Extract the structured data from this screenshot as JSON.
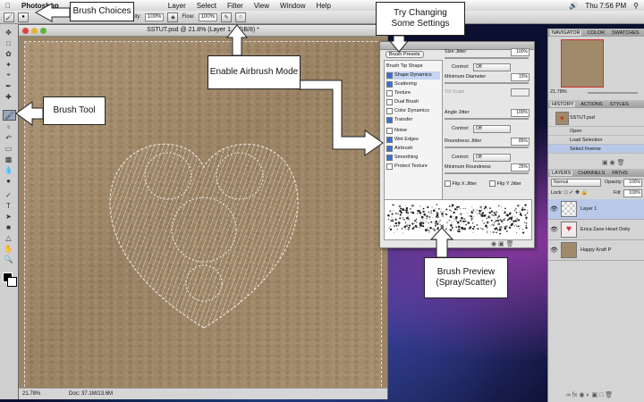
{
  "menubar": {
    "app_name": "Photoshop",
    "items": [
      "Layer",
      "Select",
      "Filter",
      "View",
      "Window",
      "Help"
    ],
    "clock": "Thu 7:56 PM"
  },
  "options_bar": {
    "opacity_label": "Opacity:",
    "opacity_value": "100%",
    "flow_label": "Flow:",
    "flow_value": "100%"
  },
  "document": {
    "title": "SSTUT.psd @ 21.8% (Layer 1, RGB/8) *",
    "zoom": "21.78%",
    "doc_size": "Doc: 37.1M/13.6M"
  },
  "brush_panel": {
    "presets_button": "Brush Presets",
    "options": [
      {
        "label": "Brush Tip Shape",
        "checked": false,
        "selected": false
      },
      {
        "label": "Shape Dynamics",
        "checked": true,
        "selected": true
      },
      {
        "label": "Scattering",
        "checked": true,
        "selected": false
      },
      {
        "label": "Texture",
        "checked": false,
        "selected": false
      },
      {
        "label": "Dual Brush",
        "checked": false,
        "selected": false
      },
      {
        "label": "Color Dynamics",
        "checked": false,
        "selected": false
      },
      {
        "label": "Transfer",
        "checked": true,
        "selected": false
      },
      {
        "label": "Noise",
        "checked": false,
        "selected": false
      },
      {
        "label": "Wet Edges",
        "checked": true,
        "selected": false
      },
      {
        "label": "Airbrush",
        "checked": true,
        "selected": false
      },
      {
        "label": "Smoothing",
        "checked": true,
        "selected": false
      },
      {
        "label": "Protect Texture",
        "checked": false,
        "selected": false
      }
    ],
    "size_jitter_label": "Size Jitter",
    "size_jitter_value": "100%",
    "control_label": "Control:",
    "control_value": "Off",
    "min_diameter_label": "Minimum Diameter",
    "min_diameter_value": "15%",
    "tilt_scale_label": "Tilt Scale",
    "angle_jitter_label": "Angle Jitter",
    "angle_jitter_value": "100%",
    "roundness_jitter_label": "Roundness Jitter",
    "roundness_jitter_value": "85%",
    "min_roundness_label": "Minimum Roundness",
    "min_roundness_value": "25%",
    "flip_x_label": "Flip X Jitter",
    "flip_y_label": "Flip Y Jitter"
  },
  "right_panels": {
    "nav_tabs": [
      "NAVIGATOR",
      "COLOR",
      "SWATCHES"
    ],
    "nav_zoom": "21.78%",
    "history_tabs": [
      "HISTORY",
      "ACTIONS",
      "STYLES"
    ],
    "history_items": [
      "SSTUT.psd",
      "Open",
      "Load Selection",
      "Select Inverse"
    ],
    "layers_tabs": [
      "LAYERS",
      "CHANNELS",
      "PATHS"
    ],
    "blend_mode": "Normal",
    "opacity_label": "Opacity:",
    "opacity_value": "100%",
    "lock_label": "Lock:",
    "fill_label": "Fill:",
    "fill_value": "100%",
    "layers": [
      "Layer 1",
      "Erica Zane Heart Doily",
      "Happy Kraft P"
    ]
  },
  "callouts": {
    "brush_choices": "Brush Choices",
    "brush_tool": "Brush Tool",
    "airbrush_mode": "Enable Airbrush Mode",
    "try_settings": "Try Changing Some Settings",
    "brush_preview": "Brush Preview (Spray/Scatter)"
  },
  "colors": {
    "kraft": "#a08a69",
    "callout_bg": "#ffffff",
    "selection_blue": "#c4d4f2"
  }
}
